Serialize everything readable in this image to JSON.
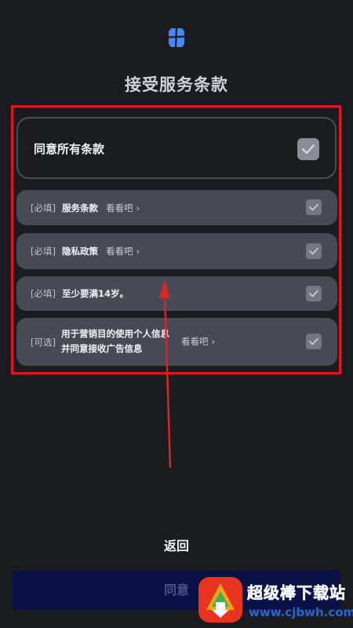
{
  "header": {
    "title": "接受服务条款",
    "logo_icon": "app-logo-icon"
  },
  "agree_all": {
    "label": "同意所有条款",
    "checked": true
  },
  "terms": [
    {
      "tag": "[必填]",
      "name": "服务条款",
      "view": "看看吧",
      "checked": true
    },
    {
      "tag": "[必填]",
      "name": "隐私政策",
      "view": "看看吧",
      "checked": true
    },
    {
      "tag": "[必填]",
      "name": "至少要满14岁。",
      "view": "",
      "checked": true
    },
    {
      "tag": "[可选]",
      "name_line1": "用于营销目的使用个人信息",
      "name_line2": "并同意接收广告信息",
      "view": "看看吧",
      "checked": true
    }
  ],
  "footer": {
    "back_label": "返回",
    "agree_label": "同意"
  },
  "watermark": {
    "title": "超级棒下载站",
    "url": "www.cjbwh.com"
  },
  "colors": {
    "background": "#1b1c20",
    "card": "#474a55",
    "highlight": "#e3161f",
    "agree_button": "#0a1146"
  }
}
